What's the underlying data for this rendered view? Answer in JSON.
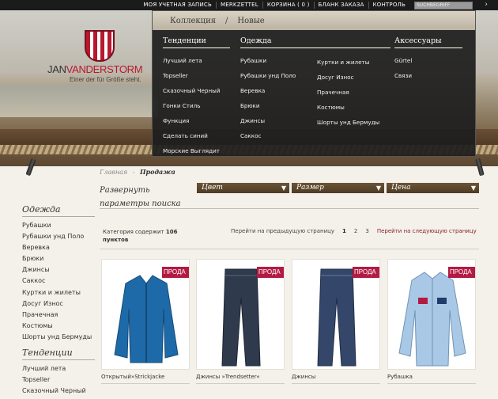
{
  "topbar": {
    "links": [
      "МОЯ УЧЕТНАЯ ЗАПИСЬ",
      "MERKZETTEL",
      "КОРЗИНА ( 0 )",
      "БЛАНК ЗАКАЗА",
      "КОНТРОЛЬ"
    ],
    "search_placeholder": "SUCHBEGRIFF",
    "search_go": "›"
  },
  "brand": {
    "name_a": "JAN",
    "name_b": "VANDERSTORM",
    "tagline": "Einer der für Größe steht."
  },
  "mega_menu": {
    "tabs": [
      "Коллекция",
      "Новые"
    ],
    "separator": "/",
    "columns": [
      {
        "heading": "Тенденции",
        "items": [
          "Лучший лета",
          "Topseller",
          "Сказочный Черный",
          "Гонки Стиль",
          "Функция",
          "Сделать синий",
          "Морские Выглядит"
        ]
      },
      {
        "heading": "Одежда",
        "items": [
          "Рубашки",
          "Рубашки унд Поло",
          "Веревка",
          "Брюки",
          "Джинсы",
          "Саккос"
        ]
      },
      {
        "heading": "",
        "items": [
          "Куртки и жилеты",
          "Досуг Износ",
          "Прачечная",
          "Костюмы",
          "Шорты унд Бермуды"
        ]
      },
      {
        "heading": "Аксессуары",
        "items": [
          "Gürtel",
          "Связи"
        ]
      }
    ]
  },
  "breadcrumb": {
    "home": "Главная",
    "sep": "-",
    "current": "Продажа"
  },
  "filters": {
    "expand": "Развернуть",
    "params": "параметры поиска",
    "bars": [
      "Цвет",
      "Размер",
      "Цена"
    ]
  },
  "listing": {
    "count_text": "Категория содержит",
    "count_value": "106",
    "count_unit": "пунктов",
    "prev": "Перейти на предыдущую страницу",
    "pages": [
      "1",
      "2",
      "3"
    ],
    "next": "Перейти на следующую страницу"
  },
  "sidebar": {
    "sections": [
      {
        "heading": "Одежда",
        "items": [
          "Рубашки",
          "Рубашки унд Поло",
          "Веревка",
          "Брюки",
          "Джинсы",
          "Саккос",
          "Куртки и жилеты",
          "Досуг Износ",
          "Прачечная",
          "Костюмы",
          "Шорты унд Бермуды"
        ]
      },
      {
        "heading": "Тенденции",
        "items": [
          "Лучший лета",
          "Topseller",
          "Сказочный Черный"
        ]
      }
    ]
  },
  "products": [
    {
      "name": "Открытый»Strickjacke",
      "badge": "ПРОДА",
      "icon": "jacket-icon",
      "color": "#1e6aa8"
    },
    {
      "name": "Джинсы »Trendsetter«",
      "badge": "ПРОДА",
      "icon": "jeans-icon",
      "color": "#2f3a4d"
    },
    {
      "name": "Джинсы",
      "badge": "ПРОДА",
      "icon": "jeans-icon",
      "color": "#34466a"
    },
    {
      "name": "Рубашка",
      "badge": "ПРОДА",
      "icon": "shirt-icon",
      "color": "#a9c8e6"
    }
  ],
  "colors": {
    "accent": "#b31a43",
    "menu_bg": "#1e1e1e",
    "filter_bar": "#5a4530"
  }
}
